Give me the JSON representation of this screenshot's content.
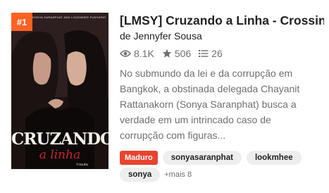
{
  "story": {
    "rank": "#1",
    "title": "[LMSY] Cruzando a Linha - Crossing...",
    "author_prefix": "de",
    "author": "Jennyfer Sousa",
    "reads": "8.1K",
    "votes": "506",
    "parts": "26",
    "description": "No submundo da lei e da corrupção em Bangkok, a obstinada delegada Chayanit Rattanakorn (Sonya Saranphat) busca a verdade em um intrincado caso de corrupção com figuras...",
    "tags": [
      "sonyasaranphat",
      "lookmhee",
      "sonya"
    ],
    "mature_label": "Maduro",
    "more_tags": "+mais 8"
  },
  "cover": {
    "credit": "SONYA SARANPHAT AND LOOKMHEE PUNYAPAT",
    "title_line1": "CRUZANDO",
    "title_line2": "a linha",
    "tiny_text": "ร่วมเล่น"
  },
  "colors": {
    "accent": "#ff6122",
    "mature": "#e8432e",
    "text": "#222222",
    "muted": "#6f6f6f",
    "tag_bg": "#eeeeee"
  },
  "icons": {
    "reads": "eye-icon",
    "votes": "star-icon",
    "parts": "list-icon"
  }
}
